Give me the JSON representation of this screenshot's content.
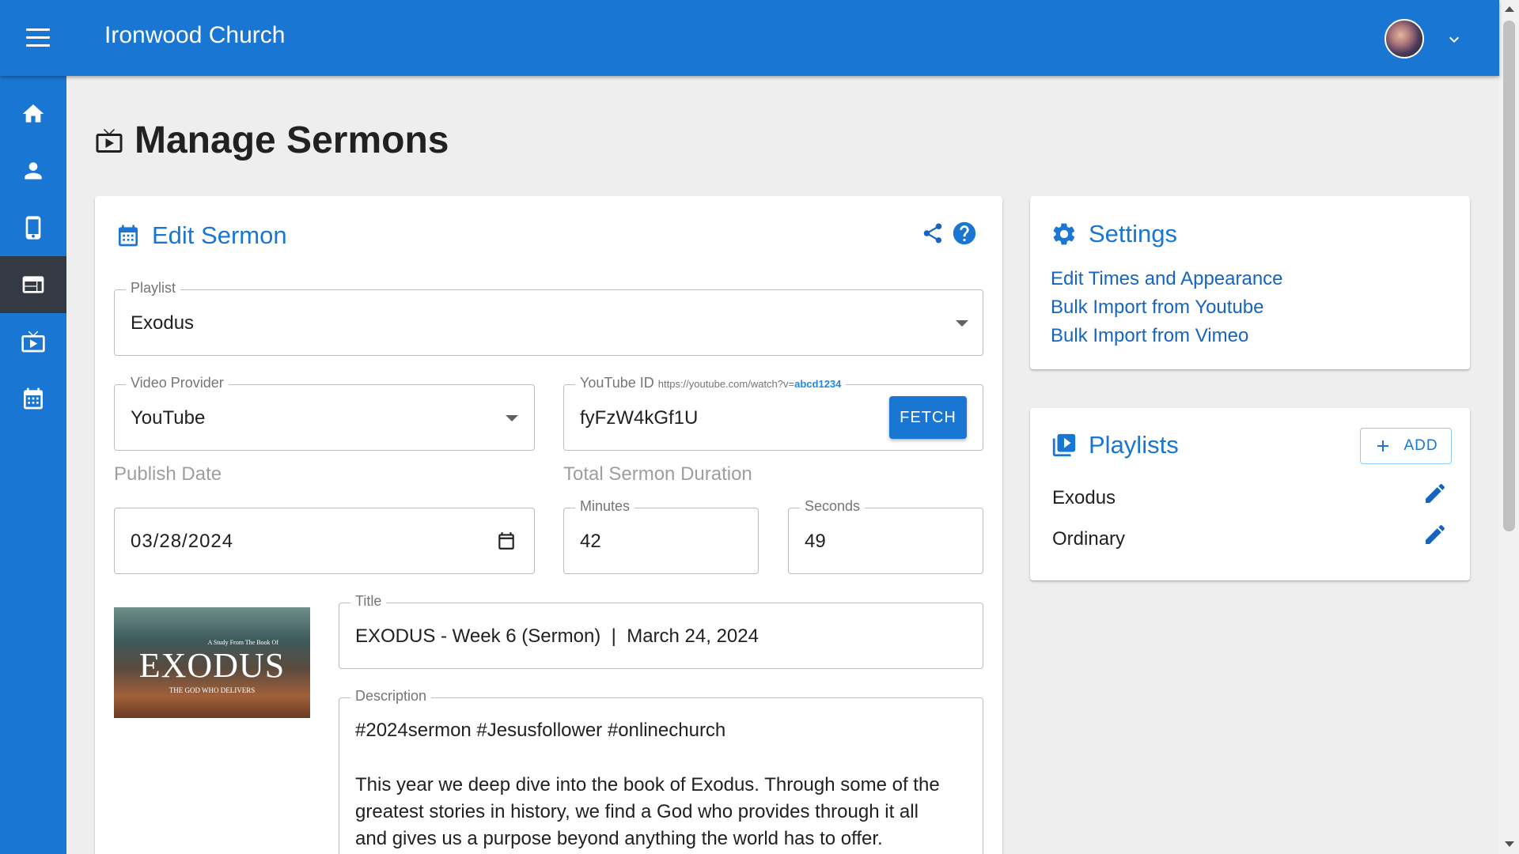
{
  "header": {
    "title": "Ironwood Church",
    "menu_icon": "menu-icon",
    "avatar_icon": "user-avatar",
    "account_chevron_icon": "chevron-down-icon"
  },
  "sidebar": {
    "items": [
      {
        "icon": "home-icon",
        "active": false
      },
      {
        "icon": "person-icon",
        "active": false
      },
      {
        "icon": "mobile-icon",
        "active": false
      },
      {
        "icon": "web-icon",
        "active": true
      },
      {
        "icon": "live-tv-icon",
        "active": false
      },
      {
        "icon": "calendar-icon",
        "active": false
      }
    ]
  },
  "page": {
    "title": "Manage Sermons",
    "title_icon": "live-tv-icon"
  },
  "edit_sermon": {
    "title": "Edit Sermon",
    "playlist": {
      "label": "Playlist",
      "value": "Exodus"
    },
    "video_provider": {
      "label": "Video Provider",
      "value": "YouTube"
    },
    "youtube_id": {
      "label": "YouTube ID",
      "hint_prefix": "https://youtube.com/watch?v=",
      "hint_highlight": "abcd1234",
      "value": "fyFzW4kGf1U",
      "fetch_label": "FETCH"
    },
    "publish_date": {
      "label": "Publish Date",
      "value": "03/28/2024"
    },
    "duration": {
      "label": "Total Sermon Duration",
      "minutes_label": "Minutes",
      "minutes": "42",
      "seconds_label": "Seconds",
      "seconds": "49"
    },
    "thumbnail": {
      "main_text": "EXODUS",
      "sub_text": "THE GOD WHO DELIVERS",
      "top_text": "A Study From The Book Of"
    },
    "title_field": {
      "label": "Title",
      "value": "EXODUS - Week 6 (Sermon)  |  March 24, 2024"
    },
    "description": {
      "label": "Description",
      "line1": "#2024sermon #Jesusfollower #onlinechurch",
      "line2": "This year we deep dive into the book of Exodus. Through some of the",
      "line3": "greatest stories in history, we find a God who provides through it all",
      "line4": "and gives us a purpose beyond anything the world has to offer."
    }
  },
  "settings": {
    "title": "Settings",
    "links": [
      "Edit Times and Appearance",
      "Bulk Import from Youtube",
      "Bulk Import from Vimeo"
    ]
  },
  "playlists": {
    "title": "Playlists",
    "add_label": "ADD",
    "items": [
      "Exodus",
      "Ordinary"
    ]
  },
  "colors": {
    "primary": "#1976d2",
    "sidebar_active": "#333a44",
    "background": "#eeeeee",
    "link": "#1565c0"
  }
}
